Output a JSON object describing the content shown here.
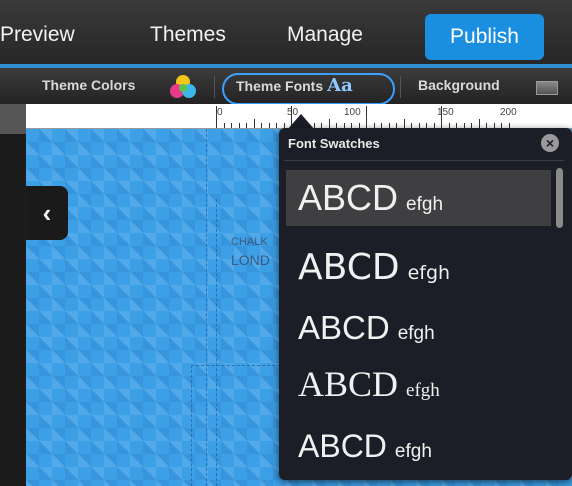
{
  "nav": {
    "items": [
      "Preview",
      "Themes",
      "Manage"
    ],
    "publish": "Publish"
  },
  "toolbar": {
    "theme_colors": "Theme Colors",
    "theme_fonts": "Theme Fonts",
    "aa": "Aa",
    "background": "Background"
  },
  "ruler": {
    "labels": [
      "0",
      "50",
      "100",
      "150",
      "200"
    ]
  },
  "canvas": {
    "text_line1": "CHALK",
    "text_line2": "LOND"
  },
  "popup": {
    "title": "Font Swatches",
    "swatches": [
      {
        "big": "ABCD",
        "small": "efgh"
      },
      {
        "big": "ABCD",
        "small": "efgh"
      },
      {
        "big": "ABCD",
        "small": "efgh"
      },
      {
        "big": "ABCD",
        "small": "efgh"
      },
      {
        "big": "ABCD",
        "small": "efgh"
      }
    ]
  },
  "colors": {
    "accent": "#1a8fe0",
    "popup_bg": "#1b1e26",
    "canvas_bg": "#3d9fe6"
  }
}
